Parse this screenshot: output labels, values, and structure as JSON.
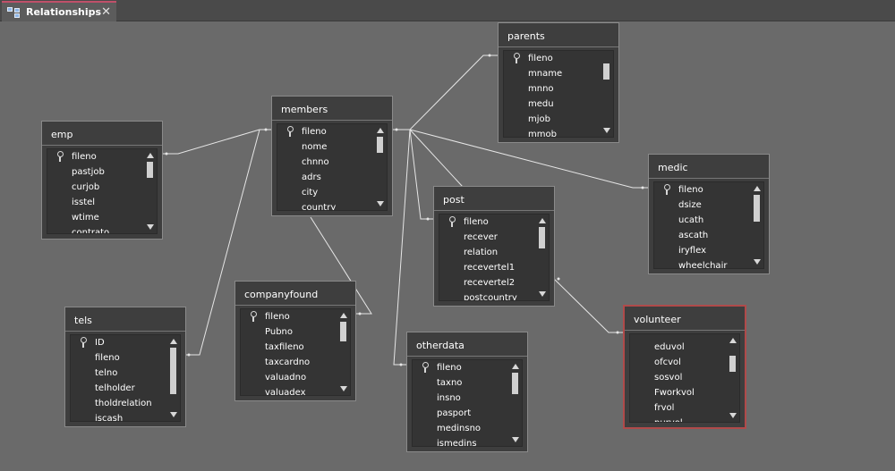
{
  "tab": {
    "title": "Relationships",
    "close": "✕",
    "icon": "relationships-icon"
  },
  "tables": {
    "emp": {
      "title": "emp",
      "fields": [
        "fileno",
        "pastjob",
        "curjob",
        "isstel",
        "wtime",
        "contrato"
      ],
      "key_index": 0
    },
    "members": {
      "title": "members",
      "fields": [
        "fileno",
        "nome",
        "chnno",
        "adrs",
        "city",
        "country"
      ],
      "key_index": 0
    },
    "parents": {
      "title": "parents",
      "fields": [
        "fileno",
        "mname",
        "mnno",
        "medu",
        "mjob",
        "mmob"
      ],
      "key_index": 0
    },
    "medic": {
      "title": "medic",
      "fields": [
        "fileno",
        "dsize",
        "ucath",
        "ascath",
        "iryflex",
        "wheelchair"
      ],
      "key_index": 0
    },
    "post": {
      "title": "post",
      "fields": [
        "fileno",
        "recever",
        "relation",
        "recevertel1",
        "recevertel2",
        "postcountry"
      ],
      "key_index": 0
    },
    "tels": {
      "title": "tels",
      "fields": [
        "ID",
        "fileno",
        "telno",
        "telholder",
        "tholdrelation",
        "iscash"
      ],
      "key_index": 0
    },
    "companyfound": {
      "title": "companyfound",
      "fields": [
        "fileno",
        "Pubno",
        "taxfileno",
        "taxcardno",
        "valuadno",
        "valuadex"
      ],
      "key_index": 0
    },
    "otherdata": {
      "title": "otherdata",
      "fields": [
        "fileno",
        "taxno",
        "insno",
        "pasport",
        "medinsno",
        "ismedins"
      ],
      "key_index": 0
    },
    "volunteer": {
      "title": "volunteer",
      "fields": [
        "eduvol",
        "ofcvol",
        "sosvol",
        "Fworkvol",
        "frvol",
        "purvol"
      ],
      "key_index": -1,
      "selected": true
    }
  },
  "colors": {
    "canvas": "#6a6a6a",
    "table_bg": "#3e3e3e",
    "selection": "#b04a4a",
    "line": "#e6e6e6"
  }
}
